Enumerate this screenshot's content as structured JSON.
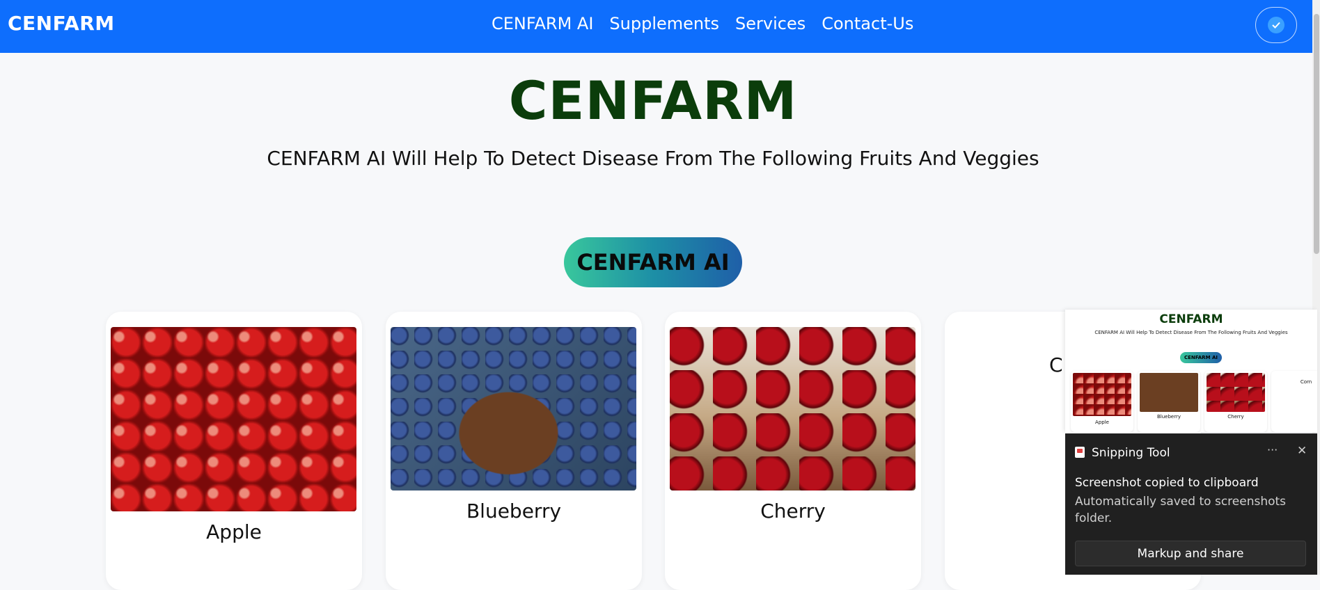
{
  "navbar": {
    "brand": "CENFARM",
    "links": [
      "CENFARM AI",
      "Supplements",
      "Services",
      "Contact-Us"
    ],
    "toggle_icon": "checkmark-toggle-icon"
  },
  "hero": {
    "title": "CENFARM",
    "subtitle": "CENFARM AI Will Help To Detect Disease From The Following Fruits And Veggies",
    "cta_label": "CENFARM AI"
  },
  "cards": [
    {
      "label": "Apple"
    },
    {
      "label": "Blueberry"
    },
    {
      "label": "Cherry"
    },
    {
      "label": "C"
    }
  ],
  "preview": {
    "title": "CENFARM",
    "subtitle": "CENFARM AI Will Help To Detect Disease From The Following Fruits And Veggies",
    "cta_label": "CENFARM AI",
    "cards": [
      "Apple",
      "Blueberry",
      "Cherry",
      "Corn"
    ]
  },
  "toast": {
    "app_name": "Snipping Tool",
    "more_label": "···",
    "close_label": "✕",
    "heading": "Screenshot copied to clipboard",
    "body": "Automatically saved to screenshots folder.",
    "button_label": "Markup and share"
  },
  "colors": {
    "nav_bg": "#0e6efd",
    "title_green": "#0b3d0b",
    "toast_bg": "#202020"
  }
}
